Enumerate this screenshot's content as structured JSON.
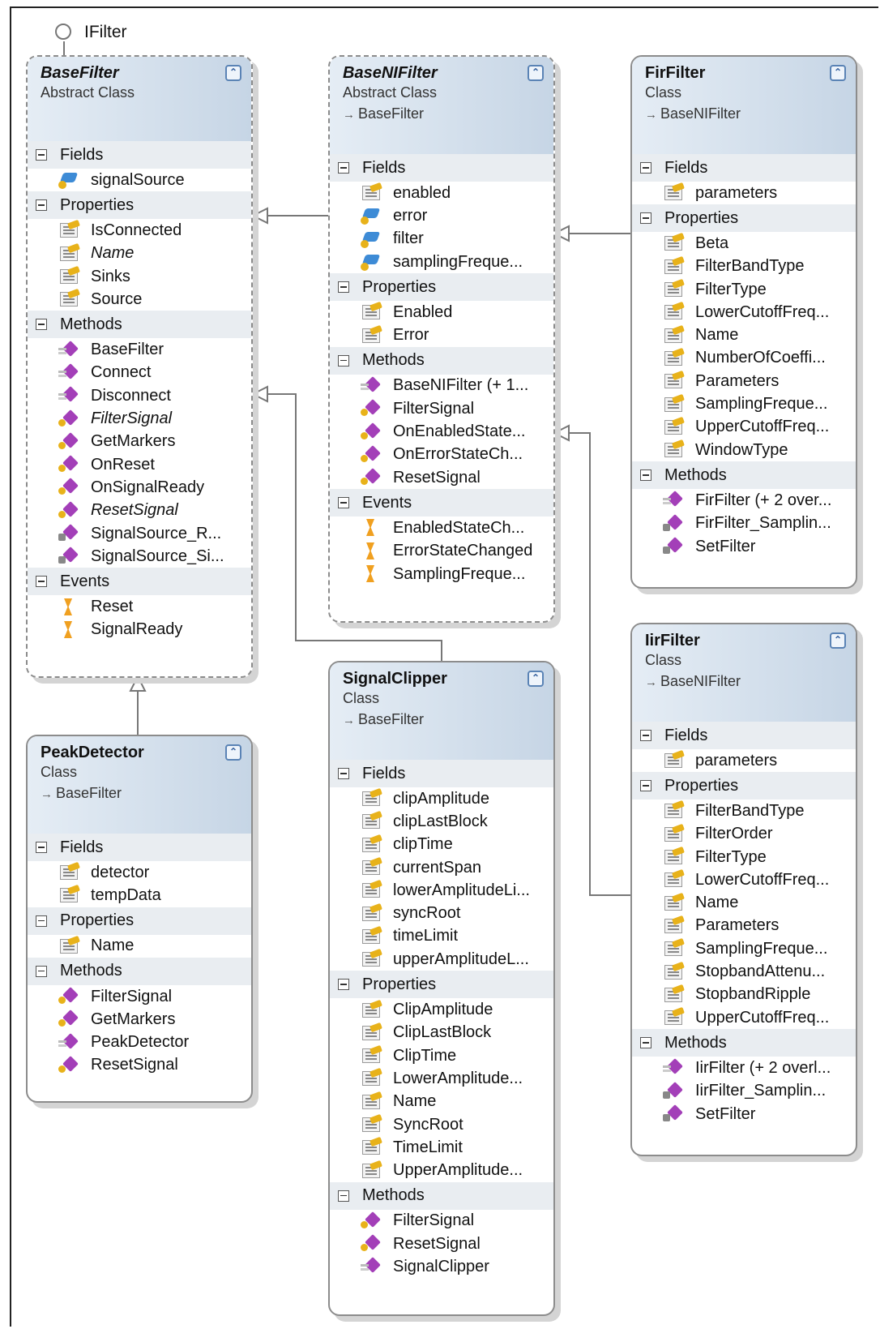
{
  "interface": {
    "name": "IFilter"
  },
  "classes": {
    "basefilter": {
      "name": "BaseFilter",
      "kind": "Abstract Class",
      "base": "",
      "sections": [
        {
          "label": "Fields",
          "members": [
            {
              "label": "signalSource",
              "icon": "field"
            }
          ]
        },
        {
          "label": "Properties",
          "members": [
            {
              "label": "IsConnected",
              "icon": "prop"
            },
            {
              "label": "Name",
              "icon": "prop",
              "italic": true
            },
            {
              "label": "Sinks",
              "icon": "prop"
            },
            {
              "label": "Source",
              "icon": "prop"
            }
          ]
        },
        {
          "label": "Methods",
          "members": [
            {
              "label": "BaseFilter",
              "icon": "meth"
            },
            {
              "label": "Connect",
              "icon": "meth"
            },
            {
              "label": "Disconnect",
              "icon": "meth"
            },
            {
              "label": "FilterSignal",
              "icon": "meth key",
              "italic": true
            },
            {
              "label": "GetMarkers",
              "icon": "meth key"
            },
            {
              "label": "OnReset",
              "icon": "meth key"
            },
            {
              "label": "OnSignalReady",
              "icon": "meth key"
            },
            {
              "label": "ResetSignal",
              "icon": "meth key",
              "italic": true
            },
            {
              "label": "SignalSource_R...",
              "icon": "meth lock"
            },
            {
              "label": "SignalSource_Si...",
              "icon": "meth lock"
            }
          ]
        },
        {
          "label": "Events",
          "members": [
            {
              "label": "Reset",
              "icon": "evt"
            },
            {
              "label": "SignalReady",
              "icon": "evt"
            }
          ]
        }
      ]
    },
    "baseni": {
      "name": "BaseNIFilter",
      "kind": "Abstract Class",
      "base": "BaseFilter",
      "sections": [
        {
          "label": "Fields",
          "members": [
            {
              "label": "enabled",
              "icon": "prop"
            },
            {
              "label": "error",
              "icon": "field"
            },
            {
              "label": "filter",
              "icon": "field"
            },
            {
              "label": "samplingFreque...",
              "icon": "field"
            }
          ]
        },
        {
          "label": "Properties",
          "members": [
            {
              "label": "Enabled",
              "icon": "prop"
            },
            {
              "label": "Error",
              "icon": "prop"
            }
          ]
        },
        {
          "label": "Methods",
          "members": [
            {
              "label": "BaseNIFilter (+ 1...",
              "icon": "meth"
            },
            {
              "label": "FilterSignal",
              "icon": "meth key"
            },
            {
              "label": "OnEnabledState...",
              "icon": "meth key"
            },
            {
              "label": "OnErrorStateCh...",
              "icon": "meth key"
            },
            {
              "label": "ResetSignal",
              "icon": "meth key"
            }
          ]
        },
        {
          "label": "Events",
          "members": [
            {
              "label": "EnabledStateCh...",
              "icon": "evt"
            },
            {
              "label": "ErrorStateChanged",
              "icon": "evt"
            },
            {
              "label": "SamplingFreque...",
              "icon": "evt"
            }
          ]
        }
      ]
    },
    "fir": {
      "name": "FirFilter",
      "kind": "Class",
      "base": "BaseNIFilter",
      "sections": [
        {
          "label": "Fields",
          "members": [
            {
              "label": "parameters",
              "icon": "prop"
            }
          ]
        },
        {
          "label": "Properties",
          "members": [
            {
              "label": "Beta",
              "icon": "prop"
            },
            {
              "label": "FilterBandType",
              "icon": "prop"
            },
            {
              "label": "FilterType",
              "icon": "prop"
            },
            {
              "label": "LowerCutoffFreq...",
              "icon": "prop"
            },
            {
              "label": "Name",
              "icon": "prop"
            },
            {
              "label": "NumberOfCoeffi...",
              "icon": "prop"
            },
            {
              "label": "Parameters",
              "icon": "prop"
            },
            {
              "label": "SamplingFreque...",
              "icon": "prop"
            },
            {
              "label": "UpperCutoffFreq...",
              "icon": "prop"
            },
            {
              "label": "WindowType",
              "icon": "prop"
            }
          ]
        },
        {
          "label": "Methods",
          "members": [
            {
              "label": "FirFilter (+ 2 over...",
              "icon": "meth"
            },
            {
              "label": "FirFilter_Samplin...",
              "icon": "meth lock"
            },
            {
              "label": "SetFilter",
              "icon": "meth lock"
            }
          ]
        }
      ]
    },
    "iir": {
      "name": "IirFilter",
      "kind": "Class",
      "base": "BaseNIFilter",
      "sections": [
        {
          "label": "Fields",
          "members": [
            {
              "label": "parameters",
              "icon": "prop"
            }
          ]
        },
        {
          "label": "Properties",
          "members": [
            {
              "label": "FilterBandType",
              "icon": "prop"
            },
            {
              "label": "FilterOrder",
              "icon": "prop"
            },
            {
              "label": "FilterType",
              "icon": "prop"
            },
            {
              "label": "LowerCutoffFreq...",
              "icon": "prop"
            },
            {
              "label": "Name",
              "icon": "prop"
            },
            {
              "label": "Parameters",
              "icon": "prop"
            },
            {
              "label": "SamplingFreque...",
              "icon": "prop"
            },
            {
              "label": "StopbandAttenu...",
              "icon": "prop"
            },
            {
              "label": "StopbandRipple",
              "icon": "prop"
            },
            {
              "label": "UpperCutoffFreq...",
              "icon": "prop"
            }
          ]
        },
        {
          "label": "Methods",
          "members": [
            {
              "label": "IirFilter (+ 2 overl...",
              "icon": "meth"
            },
            {
              "label": "IirFilter_Samplin...",
              "icon": "meth lock"
            },
            {
              "label": "SetFilter",
              "icon": "meth lock"
            }
          ]
        }
      ]
    },
    "clipper": {
      "name": "SignalClipper",
      "kind": "Class",
      "base": "BaseFilter",
      "sections": [
        {
          "label": "Fields",
          "members": [
            {
              "label": "clipAmplitude",
              "icon": "prop"
            },
            {
              "label": "clipLastBlock",
              "icon": "prop"
            },
            {
              "label": "clipTime",
              "icon": "prop"
            },
            {
              "label": "currentSpan",
              "icon": "prop"
            },
            {
              "label": "lowerAmplitudeLi...",
              "icon": "prop"
            },
            {
              "label": "syncRoot",
              "icon": "prop"
            },
            {
              "label": "timeLimit",
              "icon": "prop"
            },
            {
              "label": "upperAmplitudeL...",
              "icon": "prop"
            }
          ]
        },
        {
          "label": "Properties",
          "members": [
            {
              "label": "ClipAmplitude",
              "icon": "prop"
            },
            {
              "label": "ClipLastBlock",
              "icon": "prop"
            },
            {
              "label": "ClipTime",
              "icon": "prop"
            },
            {
              "label": "LowerAmplitude...",
              "icon": "prop"
            },
            {
              "label": "Name",
              "icon": "prop"
            },
            {
              "label": "SyncRoot",
              "icon": "prop"
            },
            {
              "label": "TimeLimit",
              "icon": "prop"
            },
            {
              "label": "UpperAmplitude...",
              "icon": "prop"
            }
          ]
        },
        {
          "label": "Methods",
          "members": [
            {
              "label": "FilterSignal",
              "icon": "meth key"
            },
            {
              "label": "ResetSignal",
              "icon": "meth key"
            },
            {
              "label": "SignalClipper",
              "icon": "meth"
            }
          ]
        }
      ]
    },
    "peak": {
      "name": "PeakDetector",
      "kind": "Class",
      "base": "BaseFilter",
      "sections": [
        {
          "label": "Fields",
          "members": [
            {
              "label": "detector",
              "icon": "prop"
            },
            {
              "label": "tempData",
              "icon": "prop"
            }
          ]
        },
        {
          "label": "Properties",
          "members": [
            {
              "label": "Name",
              "icon": "prop"
            }
          ]
        },
        {
          "label": "Methods",
          "members": [
            {
              "label": "FilterSignal",
              "icon": "meth key"
            },
            {
              "label": "GetMarkers",
              "icon": "meth key"
            },
            {
              "label": "PeakDetector",
              "icon": "meth"
            },
            {
              "label": "ResetSignal",
              "icon": "meth key"
            }
          ]
        }
      ]
    }
  }
}
